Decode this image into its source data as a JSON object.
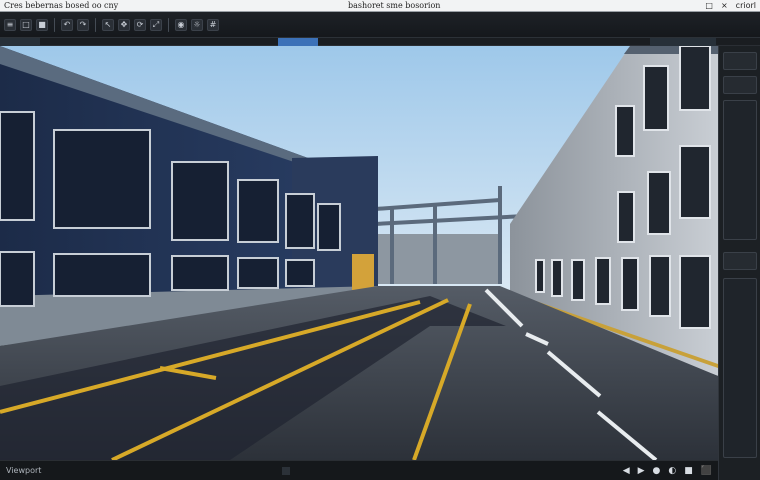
{
  "window": {
    "app_title": "Cres bebernas bosed oo cny",
    "center_title": "bashoret sme bosorion",
    "controls": [
      "□",
      "×"
    ],
    "right_label": "criorl"
  },
  "toolbar": {
    "items": [
      {
        "name": "file-icon",
        "glyph": "≡"
      },
      {
        "name": "open-icon",
        "glyph": "□"
      },
      {
        "name": "save-icon",
        "glyph": "■"
      },
      {
        "name": "undo-icon",
        "glyph": "↶"
      },
      {
        "name": "redo-icon",
        "glyph": "↷"
      },
      {
        "name": "select-icon",
        "glyph": "↖"
      },
      {
        "name": "move-icon",
        "glyph": "✥"
      },
      {
        "name": "rotate-icon",
        "glyph": "⟳"
      },
      {
        "name": "scale-icon",
        "glyph": "⤢"
      },
      {
        "name": "camera-icon",
        "glyph": "◉"
      },
      {
        "name": "light-icon",
        "glyph": "☼"
      },
      {
        "name": "grid-icon",
        "glyph": "#"
      }
    ]
  },
  "status": {
    "left_text": "Viewport",
    "icons": [
      "◀",
      "▶",
      "●",
      "◐",
      "■",
      "⬛"
    ]
  },
  "colors": {
    "sky_top": "#9ec8ea",
    "sky_bottom": "#cfe3f3",
    "building_blue": "#203457",
    "building_gray": "#8a9097",
    "road": "#343a42",
    "marking_yellow": "#d7a928"
  }
}
